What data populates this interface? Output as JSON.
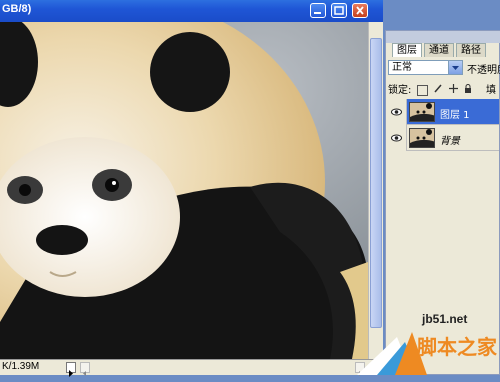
{
  "document": {
    "title": "GB/8)",
    "status": "K/1.39M"
  },
  "layers_panel": {
    "tabs": [
      "图层",
      "通道",
      "路径"
    ],
    "blend_mode": "正常",
    "opacity_label": "不透明度",
    "lock_label": "锁定:",
    "fill_label": "填充",
    "layers": [
      {
        "name": "图层 1",
        "selected": true
      },
      {
        "name": "背景",
        "selected": false
      }
    ]
  },
  "watermark": {
    "site": "jb51.net",
    "name": "脚本之家"
  },
  "colors": {
    "titlebar": "#1f56d6",
    "selected_layer": "#3a6bd6",
    "panel_bg": "#ece9d8",
    "brand_orange": "#ee8a22"
  }
}
